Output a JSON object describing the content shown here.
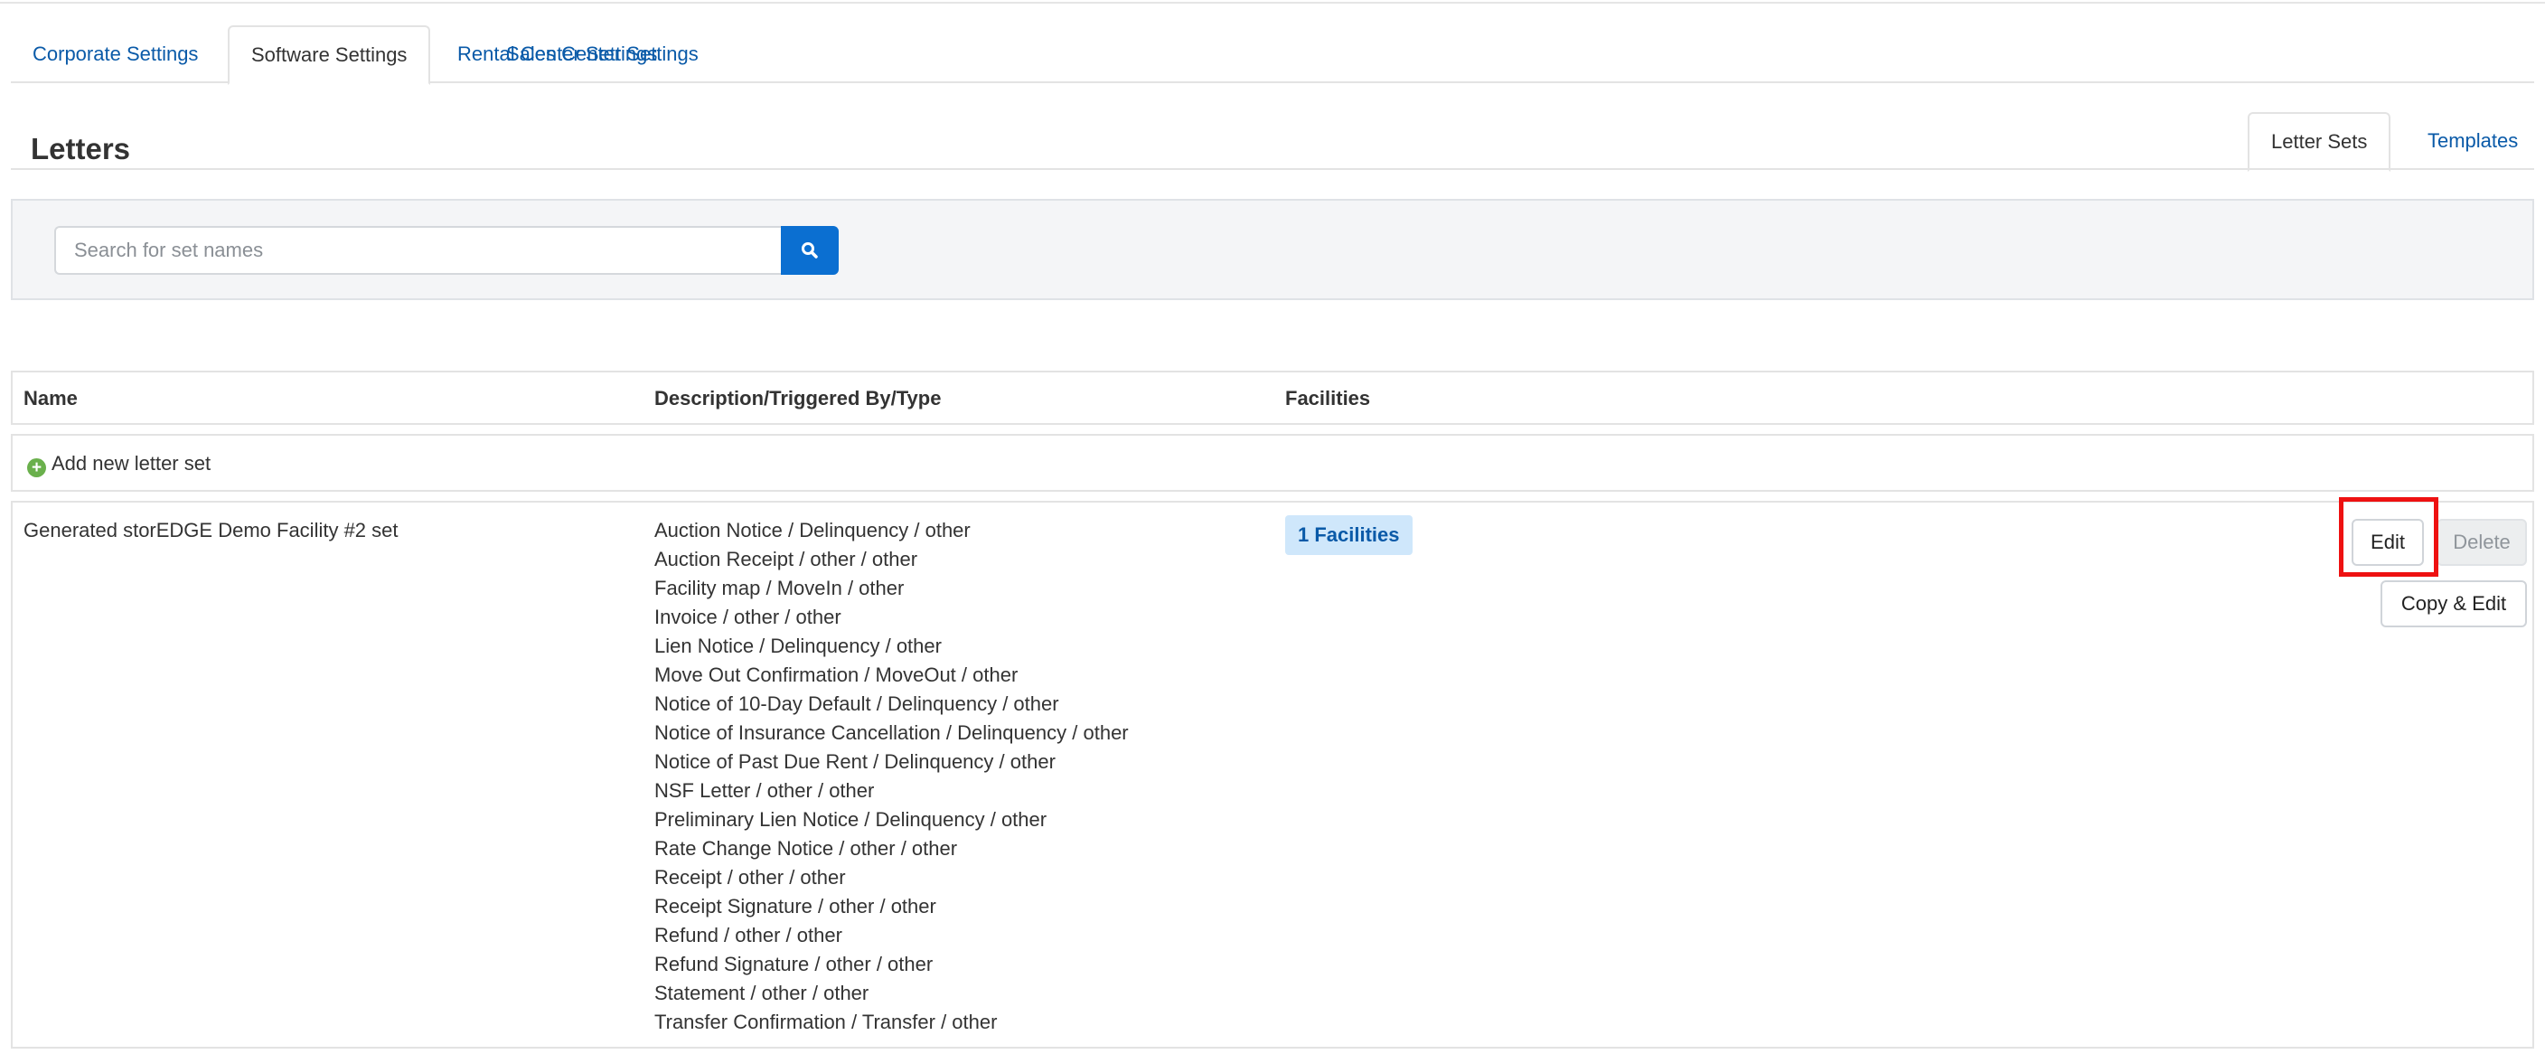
{
  "main_tabs": [
    {
      "label": "Corporate Settings",
      "active": false
    },
    {
      "label": "Software Settings",
      "active": true
    },
    {
      "label": "Rental Center Settings",
      "active": false
    },
    {
      "label": "Sales Center Settings",
      "active": false
    }
  ],
  "section": {
    "title": "Letters",
    "tabs": [
      {
        "label": "Letter Sets",
        "active": true
      },
      {
        "label": "Templates",
        "active": false
      }
    ]
  },
  "search": {
    "placeholder": "Search for set names",
    "value": "",
    "button_icon": "search-icon"
  },
  "table": {
    "headers": [
      "Name",
      "Description/Triggered By/Type",
      "Facilities"
    ],
    "add_label": "Add new letter set",
    "rows": [
      {
        "name": "Generated storEDGE Demo Facility #2 set",
        "descriptions": [
          "Auction Notice / Delinquency / other",
          "Auction Receipt / other / other",
          "Facility map / MoveIn / other",
          "Invoice / other / other",
          "Lien Notice / Delinquency / other",
          "Move Out Confirmation / MoveOut / other",
          "Notice of 10-Day Default / Delinquency / other",
          "Notice of Insurance Cancellation / Delinquency / other",
          "Notice of Past Due Rent / Delinquency / other",
          "NSF Letter / other / other",
          "Preliminary Lien Notice / Delinquency / other",
          "Rate Change Notice / other / other",
          "Receipt / other / other",
          "Receipt Signature / other / other",
          "Refund / other / other",
          "Refund Signature / other / other",
          "Statement / other / other",
          "Transfer Confirmation / Transfer / other"
        ],
        "facilities": "1 Facilities",
        "actions": {
          "edit": "Edit",
          "delete": "Delete",
          "copy_edit": "Copy & Edit"
        }
      }
    ]
  },
  "colors": {
    "link": "#0a5aa8",
    "primary_button": "#0b6fd1",
    "badge_bg": "#cfe7fb",
    "add_icon": "#6ab04c",
    "highlight": "#ee1111"
  }
}
